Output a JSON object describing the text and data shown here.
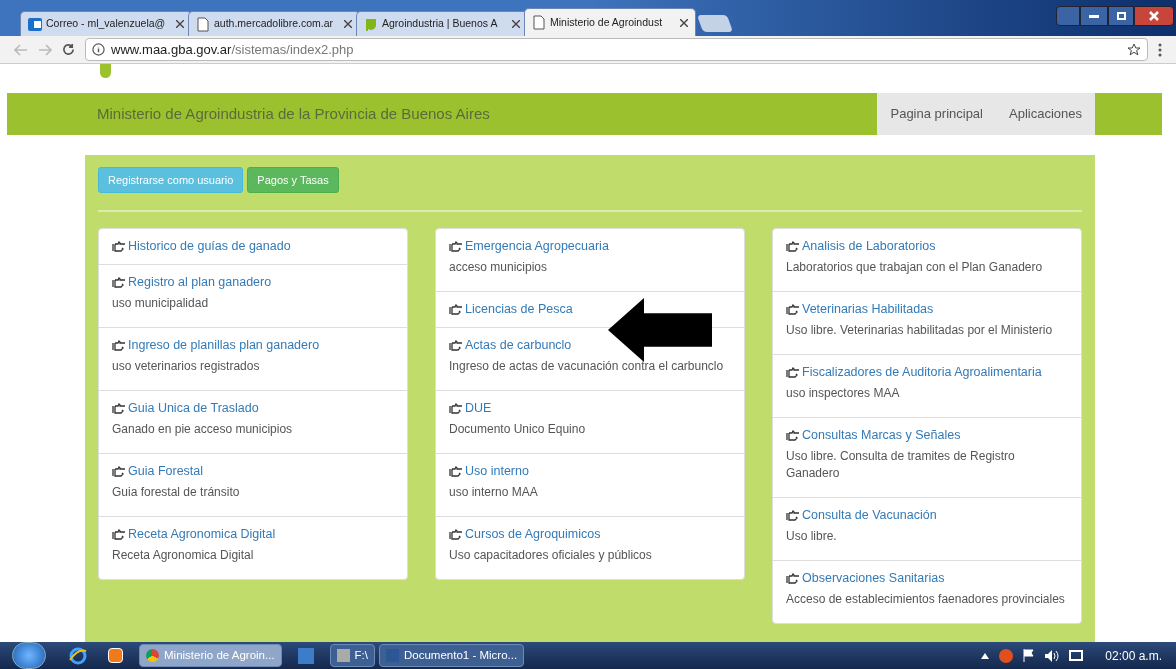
{
  "tabs": [
    {
      "title": "Correo - ml_valenzuela@",
      "selected": false
    },
    {
      "title": "auth.mercadolibre.com.ar",
      "selected": false
    },
    {
      "title": "Agroindustria | Buenos A",
      "selected": false
    },
    {
      "title": "Ministerio de Agroindust",
      "selected": true
    }
  ],
  "address": {
    "host": "www.maa.gba.gov.ar",
    "path": "/sistemas/index2.php"
  },
  "site": {
    "title": "Ministerio de Agroindustria de la Provincia de Buenos Aires",
    "nav": [
      "Pagina principal",
      "Aplicaciones"
    ]
  },
  "buttons": [
    {
      "label": "Registrarse como usuario",
      "kind": "info"
    },
    {
      "label": "Pagos y Tasas",
      "kind": "success"
    }
  ],
  "columns": [
    [
      {
        "title": "Historico de guías de ganado"
      },
      {
        "title": "Registro al plan ganadero",
        "description": "uso municipalidad"
      },
      {
        "title": "Ingreso de planillas plan ganadero",
        "description": "uso veterinarios registrados"
      },
      {
        "title": "Guia Unica de Traslado",
        "description": "Ganado en pie acceso municipios"
      },
      {
        "title": "Guia Forestal",
        "description": "Guia forestal de tránsito"
      },
      {
        "title": "Receta Agronomica Digital",
        "description": "Receta Agronomica Digital"
      }
    ],
    [
      {
        "title": "Emergencia Agropecuaria",
        "description": "acceso municipios"
      },
      {
        "title": "Licencias de Pesca"
      },
      {
        "title": "Actas de carbunclo",
        "description": "Ingreso de actas de vacunación contra el carbunclo"
      },
      {
        "title": "DUE",
        "description": "Documento Unico Equino"
      },
      {
        "title": "Uso interno",
        "description": "uso interno MAA"
      },
      {
        "title": "Cursos de Agroquimicos",
        "description": "Uso capacitadores oficiales y públicos"
      }
    ],
    [
      {
        "title": "Analisis de Laboratorios",
        "description": "Laboratorios que trabajan con el Plan Ganadero"
      },
      {
        "title": "Veterinarias Habilitadas",
        "description": "Uso libre. Veterinarias habilitadas por el Ministerio"
      },
      {
        "title": "Fiscalizadores de Auditoria Agroalimentaria",
        "description": "uso inspectores MAA"
      },
      {
        "title": "Consultas Marcas y Señales",
        "description": "Uso libre. Consulta de tramites de Registro Ganadero"
      },
      {
        "title": "Consulta de Vacunación",
        "description": "Uso libre."
      },
      {
        "title": "Observaciones Sanitarias",
        "description": "Acceso de establecimientos faenadores provinciales"
      }
    ]
  ],
  "taskbar": {
    "items": [
      {
        "label": "Ministerio de Agroin...",
        "selected": true
      },
      {
        "label": "F:\\",
        "selected": false
      },
      {
        "label": "Documento1 - Micro...",
        "selected": false
      }
    ],
    "clock": "02:00 a.m."
  }
}
